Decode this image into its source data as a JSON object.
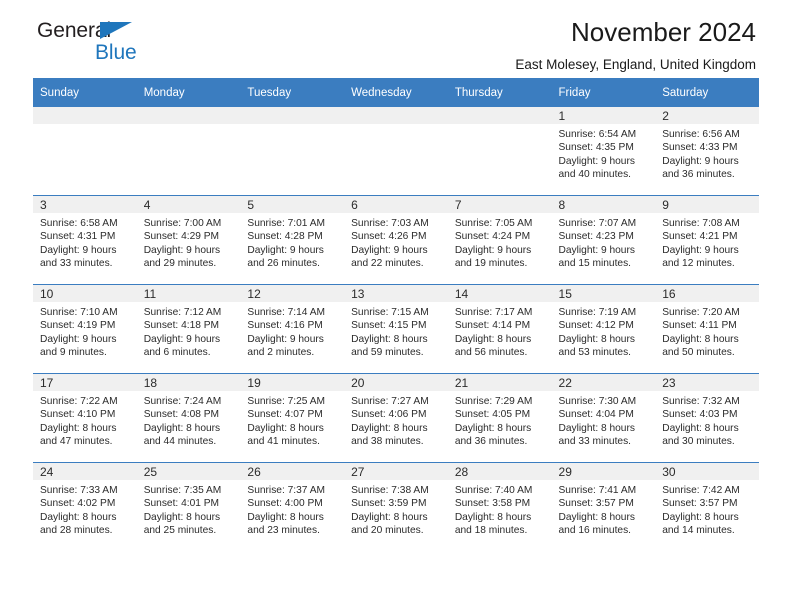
{
  "brand": {
    "line1": "General",
    "line2": "Blue",
    "triangle_icon": "triangle-icon",
    "color_dark": "#231f20",
    "color_blue": "#1f76bc"
  },
  "header": {
    "title": "November 2024",
    "subtitle": "East Molesey, England, United Kingdom"
  },
  "theme": {
    "header_row_bg": "#3b7dc0",
    "header_row_text": "#ffffff",
    "daynum_bg": "#f0f0f0",
    "row_divider": "#3b7dc0"
  },
  "calendar": {
    "weekdays": [
      "Sunday",
      "Monday",
      "Tuesday",
      "Wednesday",
      "Thursday",
      "Friday",
      "Saturday"
    ],
    "weeks": [
      [
        {
          "day": "",
          "sunrise": "",
          "sunset": "",
          "daylight_line1": "",
          "daylight_line2": "",
          "empty": true
        },
        {
          "day": "",
          "sunrise": "",
          "sunset": "",
          "daylight_line1": "",
          "daylight_line2": "",
          "empty": true
        },
        {
          "day": "",
          "sunrise": "",
          "sunset": "",
          "daylight_line1": "",
          "daylight_line2": "",
          "empty": true
        },
        {
          "day": "",
          "sunrise": "",
          "sunset": "",
          "daylight_line1": "",
          "daylight_line2": "",
          "empty": true
        },
        {
          "day": "",
          "sunrise": "",
          "sunset": "",
          "daylight_line1": "",
          "daylight_line2": "",
          "empty": true
        },
        {
          "day": "1",
          "sunrise": "Sunrise: 6:54 AM",
          "sunset": "Sunset: 4:35 PM",
          "daylight_line1": "Daylight: 9 hours",
          "daylight_line2": "and 40 minutes."
        },
        {
          "day": "2",
          "sunrise": "Sunrise: 6:56 AM",
          "sunset": "Sunset: 4:33 PM",
          "daylight_line1": "Daylight: 9 hours",
          "daylight_line2": "and 36 minutes."
        }
      ],
      [
        {
          "day": "3",
          "sunrise": "Sunrise: 6:58 AM",
          "sunset": "Sunset: 4:31 PM",
          "daylight_line1": "Daylight: 9 hours",
          "daylight_line2": "and 33 minutes."
        },
        {
          "day": "4",
          "sunrise": "Sunrise: 7:00 AM",
          "sunset": "Sunset: 4:29 PM",
          "daylight_line1": "Daylight: 9 hours",
          "daylight_line2": "and 29 minutes."
        },
        {
          "day": "5",
          "sunrise": "Sunrise: 7:01 AM",
          "sunset": "Sunset: 4:28 PM",
          "daylight_line1": "Daylight: 9 hours",
          "daylight_line2": "and 26 minutes."
        },
        {
          "day": "6",
          "sunrise": "Sunrise: 7:03 AM",
          "sunset": "Sunset: 4:26 PM",
          "daylight_line1": "Daylight: 9 hours",
          "daylight_line2": "and 22 minutes."
        },
        {
          "day": "7",
          "sunrise": "Sunrise: 7:05 AM",
          "sunset": "Sunset: 4:24 PM",
          "daylight_line1": "Daylight: 9 hours",
          "daylight_line2": "and 19 minutes."
        },
        {
          "day": "8",
          "sunrise": "Sunrise: 7:07 AM",
          "sunset": "Sunset: 4:23 PM",
          "daylight_line1": "Daylight: 9 hours",
          "daylight_line2": "and 15 minutes."
        },
        {
          "day": "9",
          "sunrise": "Sunrise: 7:08 AM",
          "sunset": "Sunset: 4:21 PM",
          "daylight_line1": "Daylight: 9 hours",
          "daylight_line2": "and 12 minutes."
        }
      ],
      [
        {
          "day": "10",
          "sunrise": "Sunrise: 7:10 AM",
          "sunset": "Sunset: 4:19 PM",
          "daylight_line1": "Daylight: 9 hours",
          "daylight_line2": "and 9 minutes."
        },
        {
          "day": "11",
          "sunrise": "Sunrise: 7:12 AM",
          "sunset": "Sunset: 4:18 PM",
          "daylight_line1": "Daylight: 9 hours",
          "daylight_line2": "and 6 minutes."
        },
        {
          "day": "12",
          "sunrise": "Sunrise: 7:14 AM",
          "sunset": "Sunset: 4:16 PM",
          "daylight_line1": "Daylight: 9 hours",
          "daylight_line2": "and 2 minutes."
        },
        {
          "day": "13",
          "sunrise": "Sunrise: 7:15 AM",
          "sunset": "Sunset: 4:15 PM",
          "daylight_line1": "Daylight: 8 hours",
          "daylight_line2": "and 59 minutes."
        },
        {
          "day": "14",
          "sunrise": "Sunrise: 7:17 AM",
          "sunset": "Sunset: 4:14 PM",
          "daylight_line1": "Daylight: 8 hours",
          "daylight_line2": "and 56 minutes."
        },
        {
          "day": "15",
          "sunrise": "Sunrise: 7:19 AM",
          "sunset": "Sunset: 4:12 PM",
          "daylight_line1": "Daylight: 8 hours",
          "daylight_line2": "and 53 minutes."
        },
        {
          "day": "16",
          "sunrise": "Sunrise: 7:20 AM",
          "sunset": "Sunset: 4:11 PM",
          "daylight_line1": "Daylight: 8 hours",
          "daylight_line2": "and 50 minutes."
        }
      ],
      [
        {
          "day": "17",
          "sunrise": "Sunrise: 7:22 AM",
          "sunset": "Sunset: 4:10 PM",
          "daylight_line1": "Daylight: 8 hours",
          "daylight_line2": "and 47 minutes."
        },
        {
          "day": "18",
          "sunrise": "Sunrise: 7:24 AM",
          "sunset": "Sunset: 4:08 PM",
          "daylight_line1": "Daylight: 8 hours",
          "daylight_line2": "and 44 minutes."
        },
        {
          "day": "19",
          "sunrise": "Sunrise: 7:25 AM",
          "sunset": "Sunset: 4:07 PM",
          "daylight_line1": "Daylight: 8 hours",
          "daylight_line2": "and 41 minutes."
        },
        {
          "day": "20",
          "sunrise": "Sunrise: 7:27 AM",
          "sunset": "Sunset: 4:06 PM",
          "daylight_line1": "Daylight: 8 hours",
          "daylight_line2": "and 38 minutes."
        },
        {
          "day": "21",
          "sunrise": "Sunrise: 7:29 AM",
          "sunset": "Sunset: 4:05 PM",
          "daylight_line1": "Daylight: 8 hours",
          "daylight_line2": "and 36 minutes."
        },
        {
          "day": "22",
          "sunrise": "Sunrise: 7:30 AM",
          "sunset": "Sunset: 4:04 PM",
          "daylight_line1": "Daylight: 8 hours",
          "daylight_line2": "and 33 minutes."
        },
        {
          "day": "23",
          "sunrise": "Sunrise: 7:32 AM",
          "sunset": "Sunset: 4:03 PM",
          "daylight_line1": "Daylight: 8 hours",
          "daylight_line2": "and 30 minutes."
        }
      ],
      [
        {
          "day": "24",
          "sunrise": "Sunrise: 7:33 AM",
          "sunset": "Sunset: 4:02 PM",
          "daylight_line1": "Daylight: 8 hours",
          "daylight_line2": "and 28 minutes."
        },
        {
          "day": "25",
          "sunrise": "Sunrise: 7:35 AM",
          "sunset": "Sunset: 4:01 PM",
          "daylight_line1": "Daylight: 8 hours",
          "daylight_line2": "and 25 minutes."
        },
        {
          "day": "26",
          "sunrise": "Sunrise: 7:37 AM",
          "sunset": "Sunset: 4:00 PM",
          "daylight_line1": "Daylight: 8 hours",
          "daylight_line2": "and 23 minutes."
        },
        {
          "day": "27",
          "sunrise": "Sunrise: 7:38 AM",
          "sunset": "Sunset: 3:59 PM",
          "daylight_line1": "Daylight: 8 hours",
          "daylight_line2": "and 20 minutes."
        },
        {
          "day": "28",
          "sunrise": "Sunrise: 7:40 AM",
          "sunset": "Sunset: 3:58 PM",
          "daylight_line1": "Daylight: 8 hours",
          "daylight_line2": "and 18 minutes."
        },
        {
          "day": "29",
          "sunrise": "Sunrise: 7:41 AM",
          "sunset": "Sunset: 3:57 PM",
          "daylight_line1": "Daylight: 8 hours",
          "daylight_line2": "and 16 minutes."
        },
        {
          "day": "30",
          "sunrise": "Sunrise: 7:42 AM",
          "sunset": "Sunset: 3:57 PM",
          "daylight_line1": "Daylight: 8 hours",
          "daylight_line2": "and 14 minutes."
        }
      ]
    ]
  }
}
